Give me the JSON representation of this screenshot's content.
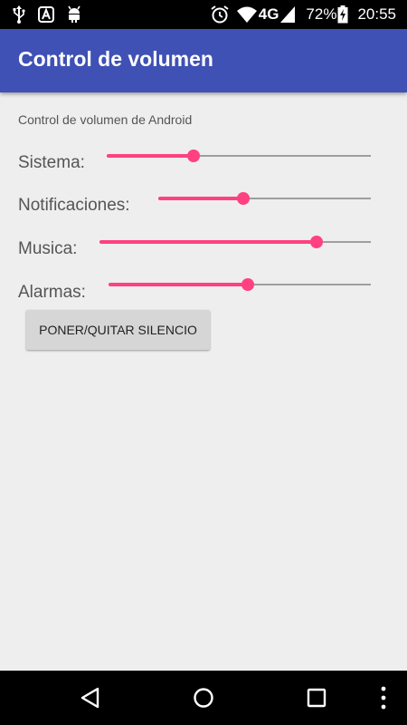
{
  "status_bar": {
    "left_icons": [
      "usb-icon",
      "android-debug-icon",
      "bug-icon"
    ],
    "network_type": "4G",
    "battery_percent": "72%",
    "time": "20:55",
    "right_icons": [
      "alarm-icon",
      "wifi-icon",
      "cell-signal-icon",
      "battery-charging-icon"
    ]
  },
  "toolbar": {
    "title": "Control de volumen",
    "color": "#3f51b5"
  },
  "content": {
    "subtitle": "Control de volumen de Android",
    "accent_color": "#ff4081",
    "sliders": [
      {
        "label": "Sistema:",
        "level": 0.33
      },
      {
        "label": "Notificaciones:",
        "level": 0.4
      },
      {
        "label": "Musica:",
        "level": 0.8
      },
      {
        "label": "Alarmas:",
        "level": 0.53
      }
    ],
    "mute_button_label": "PONER/QUITAR SILENCIO"
  },
  "nav_bar": {
    "buttons": [
      "back-icon",
      "home-icon",
      "recents-icon",
      "overflow-menu-icon"
    ]
  }
}
